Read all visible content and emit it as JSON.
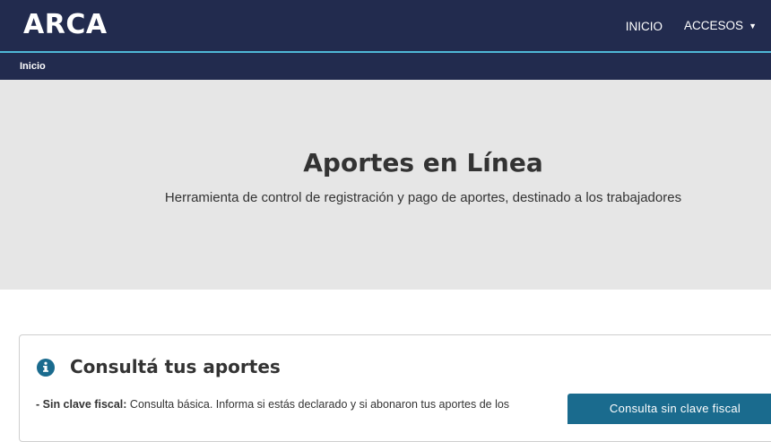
{
  "header": {
    "logo_text": "ARCA",
    "nav": {
      "inicio_label": "INICIO",
      "accesos_label": "ACCESOS"
    }
  },
  "breadcrumb": {
    "current": "Inicio"
  },
  "hero": {
    "title": "Aportes en Línea",
    "subtitle": "Herramienta de control de registración y pago de aportes, destinado a los trabajadores"
  },
  "card": {
    "title": "Consultá tus aportes",
    "item_label": "- Sin clave fiscal:",
    "item_text": " Consulta básica. Informa si estás declarado y si abonaron tus aportes de los",
    "button_label": "Consulta sin clave fiscal",
    "icon": "info-circle-icon"
  },
  "colors": {
    "header_bg": "#222b4e",
    "accent_line": "#4fb8d6",
    "hero_bg": "#e6e6e6",
    "button_bg": "#1a6b8e",
    "icon_color": "#1a6b8e"
  }
}
